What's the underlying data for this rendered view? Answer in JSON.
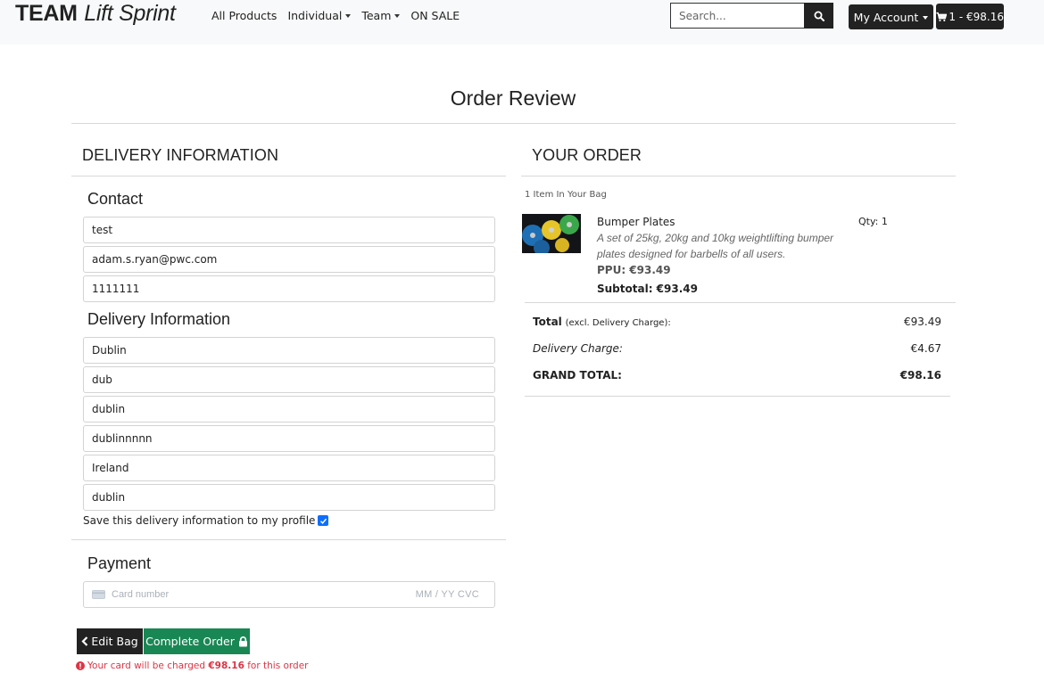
{
  "header": {
    "brand_bold": "TEAM",
    "brand_italic": "Lift Sprint",
    "nav": {
      "all_products": "All Products",
      "individual": "Individual",
      "team": "Team",
      "on_sale": "ON SALE"
    },
    "search": {
      "placeholder": "Search..."
    },
    "my_account": "My Account",
    "bag": "1 - €98.16"
  },
  "page": {
    "title": "Order Review"
  },
  "delivery": {
    "heading": "DELIVERY INFORMATION",
    "contact_heading": "Contact",
    "contact_fields": [
      "test",
      "adam.s.ryan@pwc.com",
      "1111111"
    ],
    "delivery_heading": "Delivery Information",
    "delivery_fields": [
      "Dublin",
      "dub",
      "dublin",
      "dublinnnnn",
      "Ireland",
      "dublin"
    ],
    "save_label": "Save this delivery information to my profile",
    "save_checked": true
  },
  "payment": {
    "heading": "Payment",
    "card_placeholder": "Card number",
    "card_expiry_cvc": "MM / YY  CVC"
  },
  "actions": {
    "edit_bag": "Edit Bag",
    "complete_order": "Complete Order",
    "charge_prefix": "Your card will be charged ",
    "charge_amount": "€98.16",
    "charge_suffix": " for this order"
  },
  "order": {
    "heading": "YOUR ORDER",
    "items_count": "1 Item In Your Bag",
    "item": {
      "name": "Bumper Plates",
      "description": "A set of 25kg, 20kg and 10kg weightlifting bumper plates designed for barbells of all users.",
      "ppu": "PPU: €93.49",
      "subtotal": "Subtotal: €93.49",
      "qty": "Qty: 1"
    },
    "total_label": "Total",
    "total_note": "(excl. Delivery Charge):",
    "total_value": "€93.49",
    "delivery_label": "Delivery Charge:",
    "delivery_value": "€4.67",
    "grand_total_label": "GRAND TOTAL:",
    "grand_total_value": "€98.16"
  },
  "colors": {
    "primary_dark": "#222222",
    "success": "#198754",
    "danger": "#dc3545",
    "checkbox": "#0d6efd"
  }
}
